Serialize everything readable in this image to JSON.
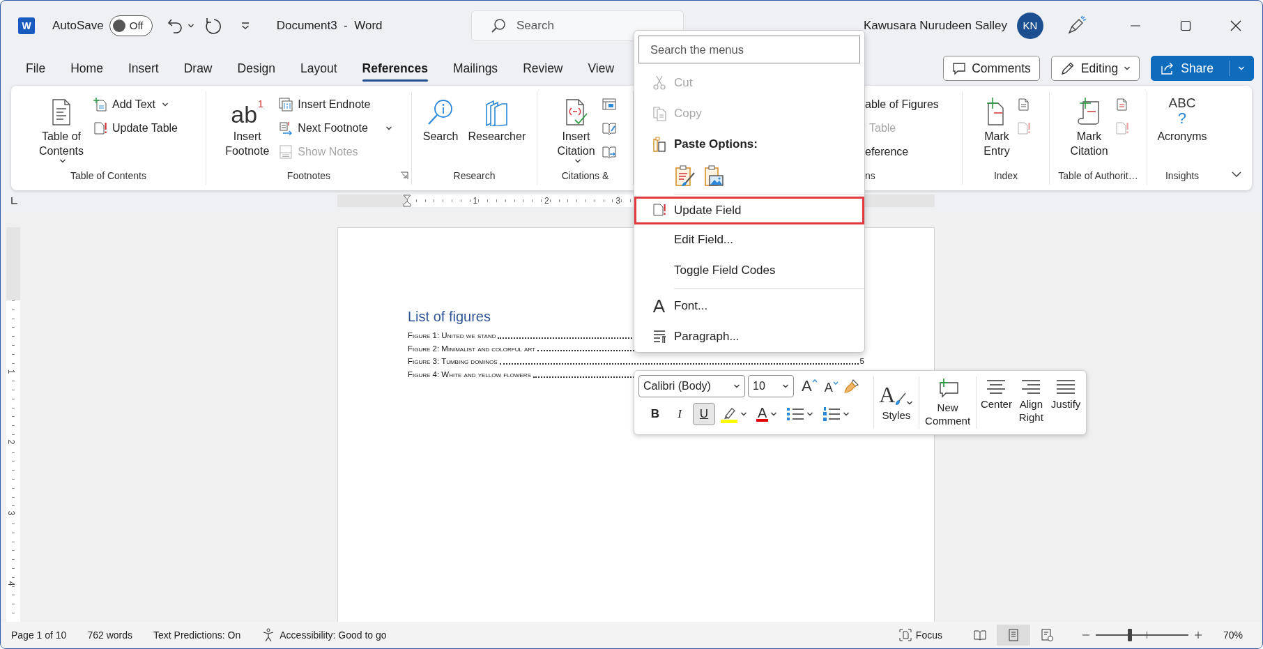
{
  "title_bar": {
    "app_icon_letter": "W",
    "autosave_label": "AutoSave",
    "autosave_toggle": {
      "on": false,
      "label": "Off"
    },
    "document_title": "Document3  -  Word",
    "search": {
      "placeholder": "Search"
    },
    "user_name": "Kawusara Nurudeen Salley",
    "avatar_initials": "KN"
  },
  "tabs": [
    {
      "label": "File",
      "selected": false
    },
    {
      "label": "Home",
      "selected": false
    },
    {
      "label": "Insert",
      "selected": false
    },
    {
      "label": "Draw",
      "selected": false
    },
    {
      "label": "Design",
      "selected": false
    },
    {
      "label": "Layout",
      "selected": false
    },
    {
      "label": "References",
      "selected": true
    },
    {
      "label": "Mailings",
      "selected": false
    },
    {
      "label": "Review",
      "selected": false
    },
    {
      "label": "View",
      "selected": false
    }
  ],
  "tab_actions": {
    "comments": "Comments",
    "editing": "Editing",
    "share": "Share"
  },
  "ribbon": {
    "groups": [
      {
        "label": "Table of Contents",
        "launcher": false,
        "items": [
          {
            "kind": "large",
            "label": "Table of\nContents",
            "dropdown": true,
            "disabled": false
          },
          {
            "kind": "small",
            "label": "Add Text",
            "dropdown": true,
            "disabled": false
          },
          {
            "kind": "small",
            "label": "Update Table",
            "dropdown": false,
            "disabled": false
          }
        ]
      },
      {
        "label": "Footnotes",
        "launcher": true,
        "items": [
          {
            "kind": "large",
            "label": "Insert\nFootnote",
            "glyph": "ab",
            "glyph_sup": "1",
            "dropdown": false,
            "disabled": false
          },
          {
            "kind": "small",
            "label": "Insert Endnote",
            "dropdown": false,
            "disabled": false
          },
          {
            "kind": "small",
            "label": "Next Footnote",
            "dropdown": true,
            "disabled": false
          },
          {
            "kind": "small",
            "label": "Show Notes",
            "dropdown": false,
            "disabled": true
          }
        ]
      },
      {
        "label": "Research",
        "launcher": false,
        "items": [
          {
            "kind": "large",
            "label": "Search",
            "dropdown": false,
            "disabled": false
          },
          {
            "kind": "large",
            "label": "Researcher",
            "dropdown": false,
            "disabled": false
          }
        ]
      },
      {
        "label": "Citations &",
        "launcher": false,
        "items": [
          {
            "kind": "large",
            "label": "Insert\nCitation",
            "dropdown": true,
            "disabled": false
          },
          {
            "kind": "icon",
            "disabled": false
          },
          {
            "kind": "icon",
            "disabled": false
          },
          {
            "kind": "icon",
            "disabled": false
          }
        ]
      },
      {
        "label": "ns",
        "launcher": false,
        "items": [
          {
            "kind": "text",
            "label": "able of Figures",
            "dropdown": false,
            "disabled": false
          },
          {
            "kind": "text",
            "label": "Table",
            "dropdown": false,
            "disabled": true
          },
          {
            "kind": "text",
            "label": "eference",
            "dropdown": false,
            "disabled": false
          }
        ]
      },
      {
        "label": "Index",
        "launcher": false,
        "items": [
          {
            "kind": "large",
            "label": "Mark\nEntry",
            "dropdown": false,
            "disabled": false
          },
          {
            "kind": "icon",
            "disabled": false
          },
          {
            "kind": "icon",
            "disabled": true
          }
        ]
      },
      {
        "label": "Table of Authorit…",
        "launcher": false,
        "items": [
          {
            "kind": "large",
            "label": "Mark\nCitation",
            "dropdown": false,
            "disabled": false
          },
          {
            "kind": "icon",
            "disabled": false
          },
          {
            "kind": "icon",
            "disabled": true
          }
        ]
      },
      {
        "label": "Insights",
        "launcher": false,
        "items": [
          {
            "kind": "large",
            "label": "Acronyms",
            "glyph": "ABC",
            "glyph_sup": "?",
            "dropdown": false,
            "disabled": false
          }
        ]
      }
    ]
  },
  "ruler": {
    "h_numbers": [
      "1",
      "2",
      "3"
    ],
    "v_numbers": [
      "1",
      "2",
      "3",
      "4"
    ]
  },
  "document": {
    "heading": "List of figures",
    "entries": [
      {
        "text": "Figure 1: United we stand"
      },
      {
        "text": "Figure 2: Minimalist and colorful art"
      },
      {
        "text": "Figure 3: Tumbing dominos",
        "page": "5"
      },
      {
        "text": "Figure 4: White and yellow flowers"
      }
    ]
  },
  "context_menu": {
    "search": {
      "placeholder": "Search the menus"
    },
    "items": [
      {
        "kind": "command",
        "label": "Cut",
        "disabled": true,
        "highlighted": false
      },
      {
        "kind": "command",
        "label": "Copy",
        "disabled": true,
        "highlighted": false
      },
      {
        "kind": "header",
        "label": "Paste Options:"
      },
      {
        "kind": "paste_icons"
      },
      {
        "kind": "separator"
      },
      {
        "kind": "command",
        "label": "Update Field",
        "disabled": false,
        "highlighted": true
      },
      {
        "kind": "command",
        "label": "Edit Field...",
        "disabled": false,
        "highlighted": false
      },
      {
        "kind": "command",
        "label": "Toggle Field Codes",
        "disabled": false,
        "highlighted": false
      },
      {
        "kind": "separator"
      },
      {
        "kind": "command",
        "label": "Font...",
        "glyph": "A",
        "disabled": false,
        "highlighted": false
      },
      {
        "kind": "command",
        "label": "Paragraph...",
        "disabled": false,
        "highlighted": false
      }
    ]
  },
  "mini_toolbar": {
    "font_name": "Calibri (Body)",
    "font_size": "10",
    "grow_glyph": "A",
    "shrink_glyph": "A",
    "format_buttons": [
      {
        "label": "B",
        "selected": false
      },
      {
        "label": "I",
        "selected": false
      },
      {
        "label": "U",
        "selected": true
      }
    ],
    "font_color_glyph": "A",
    "styles": {
      "glyph": "A",
      "label": "Styles"
    },
    "new_comment": "New\nComment",
    "align_buttons": [
      {
        "label": "Center"
      },
      {
        "label": "Align\nRight"
      },
      {
        "label": "Justify"
      }
    ]
  },
  "status_bar": {
    "page": "Page 1 of 10",
    "words": "762 words",
    "text_predictions": "Text Predictions: On",
    "accessibility": "Accessibility: Good to go",
    "focus": "Focus",
    "views": [
      {
        "selected": false
      },
      {
        "selected": true
      },
      {
        "selected": false
      }
    ],
    "zoom": {
      "level": 0.37,
      "reading": "70%"
    }
  }
}
